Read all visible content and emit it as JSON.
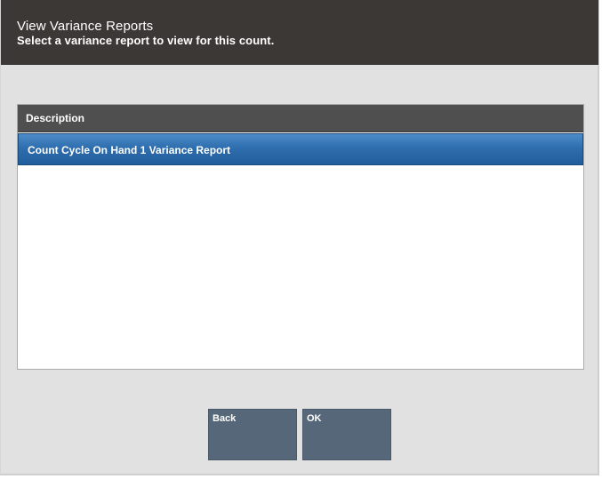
{
  "header": {
    "title": "View Variance Reports",
    "subtitle": "Select a variance report to view for this count."
  },
  "table": {
    "columns": [
      "Description"
    ],
    "rows": [
      {
        "description": "Count Cycle On Hand 1 Variance Report",
        "selected": true
      }
    ]
  },
  "buttons": {
    "back_label": "Back",
    "ok_label": "OK"
  },
  "colors": {
    "header_bg": "#3c3835",
    "column_header_bg": "#4f4f4f",
    "selected_row": "#2f6eae",
    "button_bg": "#566779"
  }
}
